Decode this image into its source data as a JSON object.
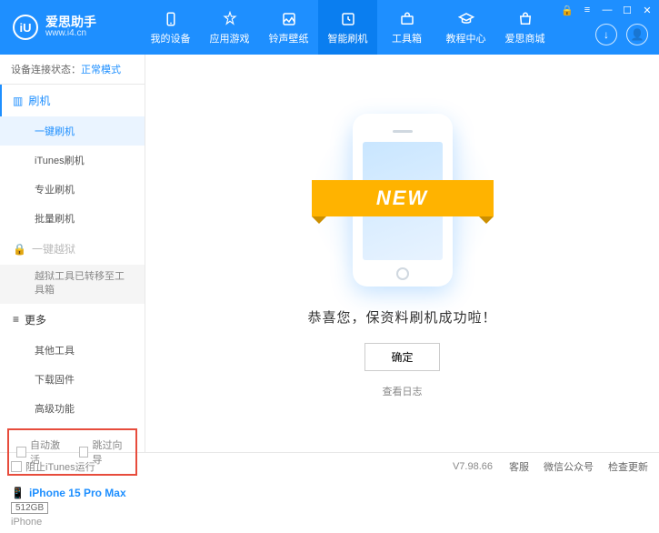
{
  "header": {
    "logo_letters": "iU",
    "title": "爱思助手",
    "url": "www.i4.cn",
    "nav": [
      {
        "label": "我的设备"
      },
      {
        "label": "应用游戏"
      },
      {
        "label": "铃声壁纸"
      },
      {
        "label": "智能刷机"
      },
      {
        "label": "工具箱"
      },
      {
        "label": "教程中心"
      },
      {
        "label": "爱思商城"
      }
    ]
  },
  "sidebar": {
    "status_label": "设备连接状态：",
    "status_value": "正常模式",
    "flash_header": "刷机",
    "flash_items": [
      "一键刷机",
      "iTunes刷机",
      "专业刷机",
      "批量刷机"
    ],
    "jailbreak_header": "一键越狱",
    "jailbreak_note": "越狱工具已转移至工具箱",
    "more_header": "更多",
    "more_items": [
      "其他工具",
      "下载固件",
      "高级功能"
    ],
    "checkbox1": "自动激活",
    "checkbox2": "跳过向导",
    "device": {
      "name": "iPhone 15 Pro Max",
      "storage": "512GB",
      "type": "iPhone"
    }
  },
  "main": {
    "ribbon": "NEW",
    "success": "恭喜您，保资料刷机成功啦！",
    "ok": "确定",
    "view_log": "查看日志"
  },
  "footer": {
    "block_itunes": "阻止iTunes运行",
    "version": "V7.98.66",
    "links": [
      "客服",
      "微信公众号",
      "检查更新"
    ]
  }
}
